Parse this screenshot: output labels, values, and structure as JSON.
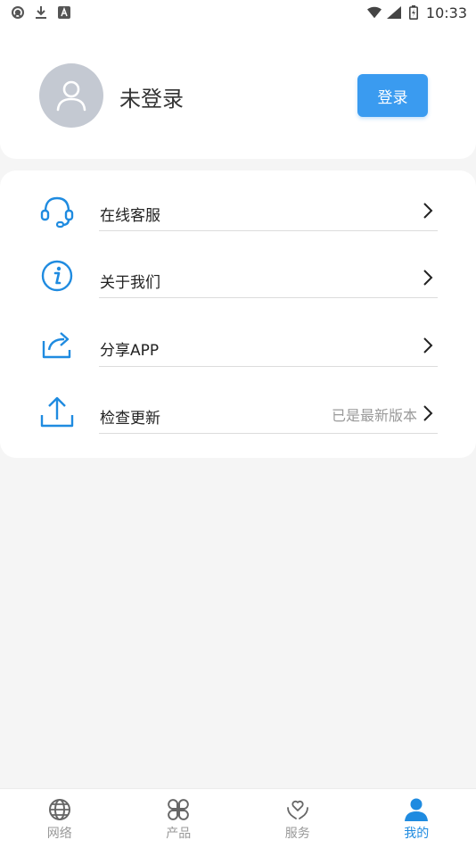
{
  "status_bar": {
    "time": "10:33",
    "icons": [
      "sync-icon",
      "download-icon",
      "a-icon",
      "wifi-icon",
      "signal-icon",
      "battery-icon"
    ]
  },
  "profile": {
    "username": "未登录",
    "login_button": "登录",
    "avatar_icon": "user-avatar-icon"
  },
  "menu": {
    "items": [
      {
        "label": "在线客服",
        "icon": "headset-icon",
        "hint": ""
      },
      {
        "label": "关于我们",
        "icon": "info-icon",
        "hint": ""
      },
      {
        "label": "分享APP",
        "icon": "share-icon",
        "hint": ""
      },
      {
        "label": "检查更新",
        "icon": "upload-icon",
        "hint": "已是最新版本"
      }
    ]
  },
  "tabbar": {
    "tabs": [
      {
        "label": "网络",
        "icon": "globe-icon",
        "active": false
      },
      {
        "label": "产品",
        "icon": "grid-icon",
        "active": false
      },
      {
        "label": "服务",
        "icon": "heart-hands-icon",
        "active": false
      },
      {
        "label": "我的",
        "icon": "user-icon",
        "active": true
      }
    ]
  },
  "colors": {
    "accent": "#3a9bf0",
    "icon_blue": "#1f8be0",
    "background": "#f5f5f5",
    "avatar_bg": "#c4c9d2"
  }
}
